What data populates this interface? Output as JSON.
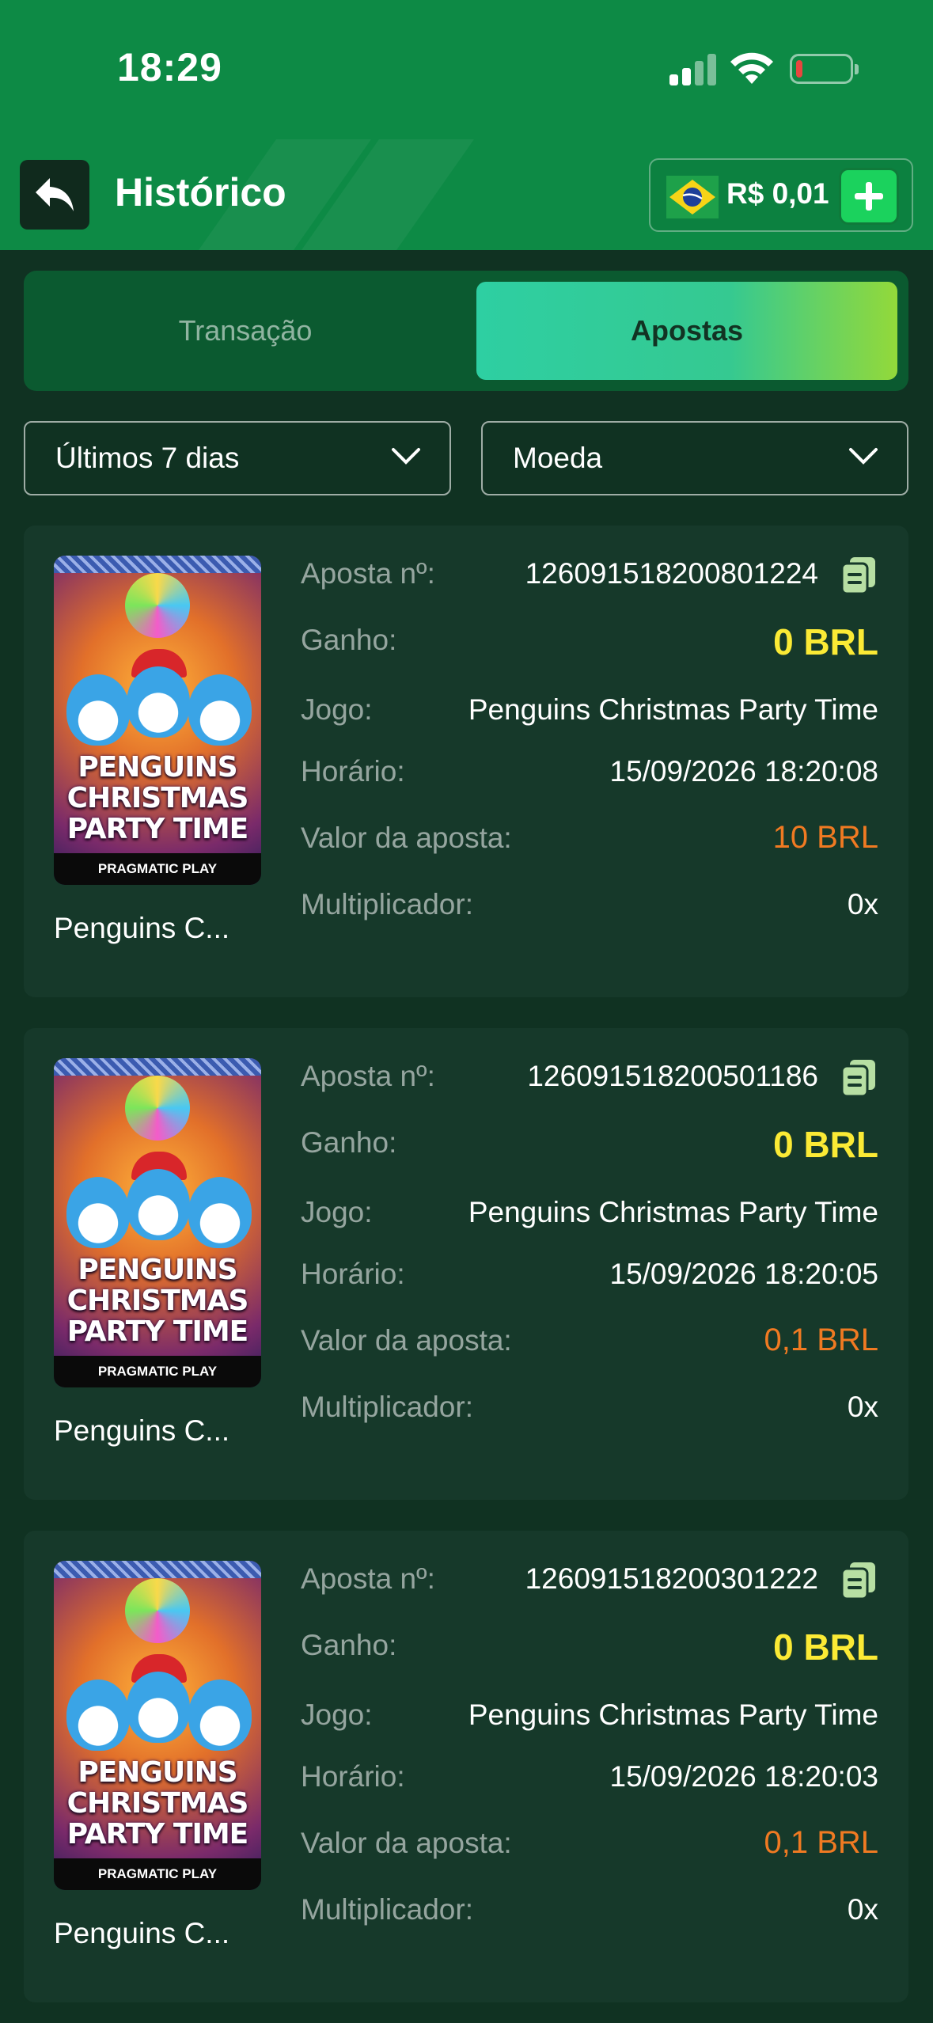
{
  "status_bar": {
    "time": "18:29"
  },
  "header": {
    "title": "Histórico",
    "balance": "R$ 0,01"
  },
  "tabs": [
    {
      "label": "Transação",
      "active": false
    },
    {
      "label": "Apostas",
      "active": true
    }
  ],
  "filters": {
    "period": "Últimos 7 dias",
    "currency": "Moeda"
  },
  "labels": {
    "bet_no": "Aposta nº:",
    "gain": "Ganho:",
    "game": "Jogo:",
    "time": "Horário:",
    "bet_value": "Valor da aposta:",
    "multiplier": "Multiplicador:"
  },
  "thumbnail": {
    "line1": "PENGUINS",
    "line2": "CHRISTMAS",
    "line3": "PARTY TIME",
    "brand": "PRAGMATIC PLAY"
  },
  "bets": [
    {
      "game_short": "Penguins C...",
      "bet_id": "126091518200801224",
      "gain": "0 BRL",
      "game": "Penguins Christmas Party Time",
      "time": "15/09/2026 18:20:08",
      "bet_value": "10 BRL",
      "multiplier": "0x"
    },
    {
      "game_short": "Penguins C...",
      "bet_id": "126091518200501186",
      "gain": "0 BRL",
      "game": "Penguins Christmas Party Time",
      "time": "15/09/2026 18:20:05",
      "bet_value": "0,1 BRL",
      "multiplier": "0x"
    },
    {
      "game_short": "Penguins C...",
      "bet_id": "126091518200301222",
      "gain": "0 BRL",
      "game": "Penguins Christmas Party Time",
      "time": "15/09/2026 18:20:03",
      "bet_value": "0,1 BRL",
      "multiplier": "0x"
    }
  ],
  "colors": {
    "header_green": "#0d8a45",
    "background": "#103222",
    "card": "#16392a",
    "gain_yellow": "#fbea35",
    "bet_orange": "#f07a22"
  }
}
